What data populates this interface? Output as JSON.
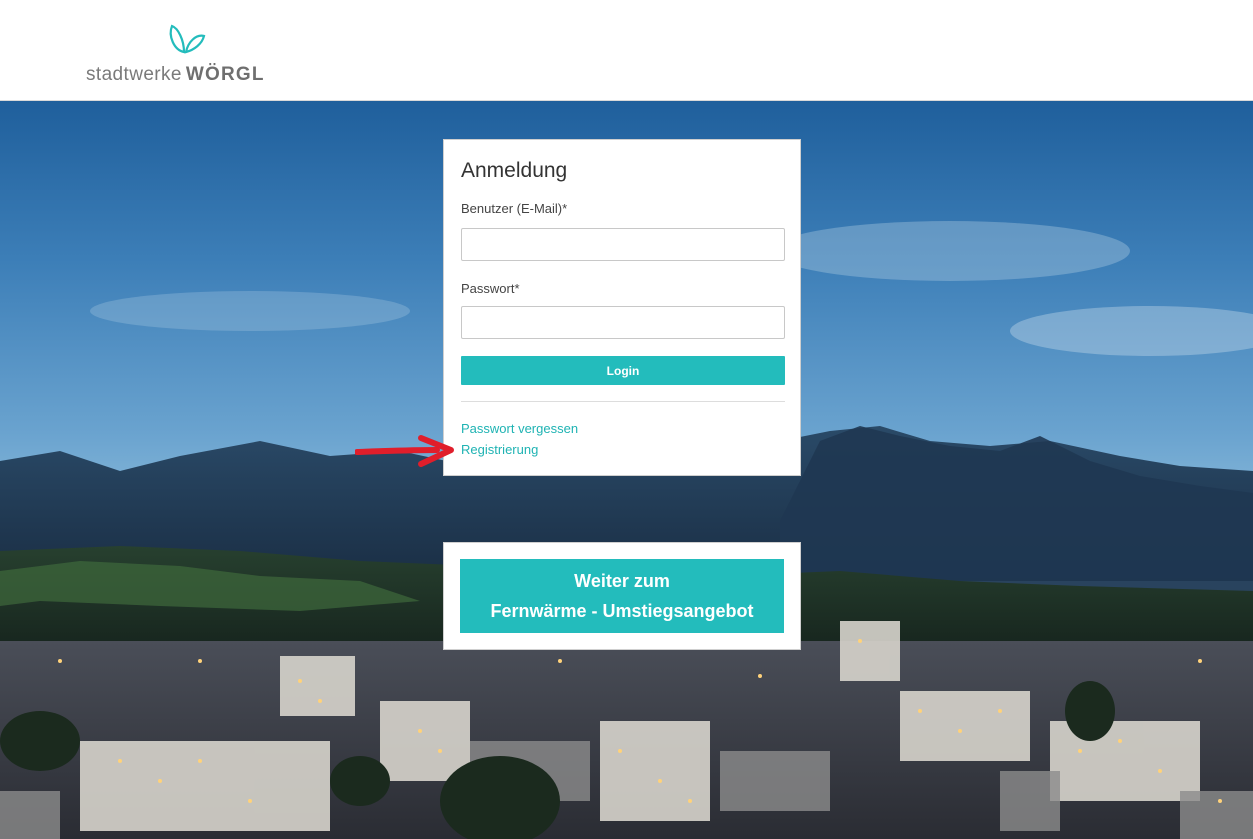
{
  "header": {
    "logo": {
      "text_light": "stadtwerke",
      "text_bold": "WÖRGL",
      "icon": "butterfly-logo-icon",
      "color": "#23bcbc"
    }
  },
  "login": {
    "title": "Anmeldung",
    "user_label": "Benutzer (E-Mail)*",
    "user_value": "",
    "password_label": "Passwort*",
    "password_value": "",
    "login_button": "Login",
    "forgot_password_link": "Passwort vergessen",
    "register_link": "Registrierung"
  },
  "cta": {
    "line1": "Weiter zum",
    "line2": "Fernwärme - Umstiegsangebot"
  },
  "colors": {
    "accent": "#23bcbc",
    "annotation_arrow": "#e01e2b"
  },
  "annotation": {
    "icon": "red-arrow-icon"
  }
}
